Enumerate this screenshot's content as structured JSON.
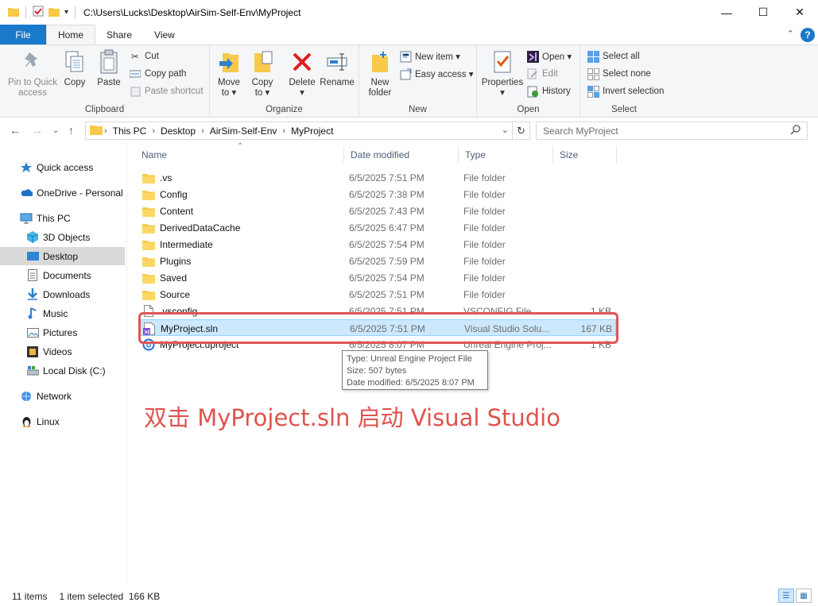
{
  "window": {
    "title_path": "C:\\Users\\Lucks\\Desktop\\AirSim-Self-Env\\MyProject",
    "controls": {
      "minimize": "—",
      "maximize": "☐",
      "close": "✕"
    }
  },
  "tabs": [
    {
      "label": "File"
    },
    {
      "label": "Home"
    },
    {
      "label": "Share"
    },
    {
      "label": "View"
    }
  ],
  "ribbon": {
    "clipboard": {
      "label": "Clipboard",
      "pin": "Pin to Quick\naccess",
      "copy": "Copy",
      "paste": "Paste",
      "cut": "Cut",
      "copy_path": "Copy path",
      "paste_shortcut": "Paste shortcut"
    },
    "organize": {
      "label": "Organize",
      "move_to": "Move\nto ▾",
      "copy_to": "Copy\nto ▾",
      "delete": "Delete\n▾",
      "rename": "Rename"
    },
    "new": {
      "label": "New",
      "new_folder": "New\nfolder",
      "new_item": "New item ▾",
      "easy_access": "Easy access ▾"
    },
    "open": {
      "label": "Open",
      "properties": "Properties\n▾",
      "open": "Open ▾",
      "edit": "Edit",
      "history": "History"
    },
    "select": {
      "label": "Select",
      "select_all": "Select all",
      "select_none": "Select none",
      "invert": "Invert selection"
    }
  },
  "address": {
    "crumbs": [
      "This PC",
      "Desktop",
      "AirSim-Self-Env",
      "MyProject"
    ],
    "search_placeholder": "Search MyProject"
  },
  "nav": [
    {
      "label": "Quick access",
      "icon": "star-icon"
    },
    {
      "label": "OneDrive - Personal",
      "icon": "cloud-icon"
    },
    {
      "label": "This PC",
      "icon": "computer-icon"
    },
    {
      "label": "3D Objects",
      "icon": "cube-icon"
    },
    {
      "label": "Desktop",
      "icon": "desktop-icon"
    },
    {
      "label": "Documents",
      "icon": "document-icon"
    },
    {
      "label": "Downloads",
      "icon": "download-icon"
    },
    {
      "label": "Music",
      "icon": "music-icon"
    },
    {
      "label": "Pictures",
      "icon": "picture-icon"
    },
    {
      "label": "Videos",
      "icon": "video-icon"
    },
    {
      "label": "Local Disk (C:)",
      "icon": "disk-icon"
    },
    {
      "label": "Network",
      "icon": "network-icon"
    },
    {
      "label": "Linux",
      "icon": "linux-icon"
    }
  ],
  "columns": {
    "name": "Name",
    "date": "Date modified",
    "type": "Type",
    "size": "Size"
  },
  "files": [
    {
      "name": ".vs",
      "date": "6/5/2025 7:51 PM",
      "type": "File folder",
      "size": "",
      "icon": "folder-icon"
    },
    {
      "name": "Config",
      "date": "6/5/2025 7:38 PM",
      "type": "File folder",
      "size": "",
      "icon": "folder-icon"
    },
    {
      "name": "Content",
      "date": "6/5/2025 7:43 PM",
      "type": "File folder",
      "size": "",
      "icon": "folder-icon"
    },
    {
      "name": "DerivedDataCache",
      "date": "6/5/2025 6:47 PM",
      "type": "File folder",
      "size": "",
      "icon": "folder-icon"
    },
    {
      "name": "Intermediate",
      "date": "6/5/2025 7:54 PM",
      "type": "File folder",
      "size": "",
      "icon": "folder-icon"
    },
    {
      "name": "Plugins",
      "date": "6/5/2025 7:59 PM",
      "type": "File folder",
      "size": "",
      "icon": "folder-icon"
    },
    {
      "name": "Saved",
      "date": "6/5/2025 7:54 PM",
      "type": "File folder",
      "size": "",
      "icon": "folder-icon"
    },
    {
      "name": "Source",
      "date": "6/5/2025 7:51 PM",
      "type": "File folder",
      "size": "",
      "icon": "folder-icon"
    },
    {
      "name": ".vsconfig",
      "date": "6/5/2025 7:51 PM",
      "type": "VSCONFIG File",
      "size": "1 KB",
      "icon": "file-icon"
    },
    {
      "name": "MyProject.sln",
      "date": "6/5/2025 7:51 PM",
      "type": "Visual Studio Solu...",
      "size": "167 KB",
      "icon": "vs-solution-icon",
      "selected": true
    },
    {
      "name": "MyProject.uproject",
      "date": "6/5/2025 8:07 PM",
      "type": "Unreal Engine Proj...",
      "size": "1 KB",
      "icon": "unreal-icon"
    }
  ],
  "tooltip": {
    "type": "Type: Unreal Engine Project File",
    "size": "Size: 507 bytes",
    "date": "Date modified: 6/5/2025 8:07 PM"
  },
  "annotation": "双击 MyProject.sln 启动 Visual Studio",
  "status": {
    "items": "11 items",
    "selected": "1 item selected  166 KB"
  },
  "colors": {
    "accent": "#1979ca",
    "selection": "#cce8ff",
    "highlight_border": "#e05555",
    "annotation_text": "#e0534f",
    "folder": "#f8c94a"
  }
}
